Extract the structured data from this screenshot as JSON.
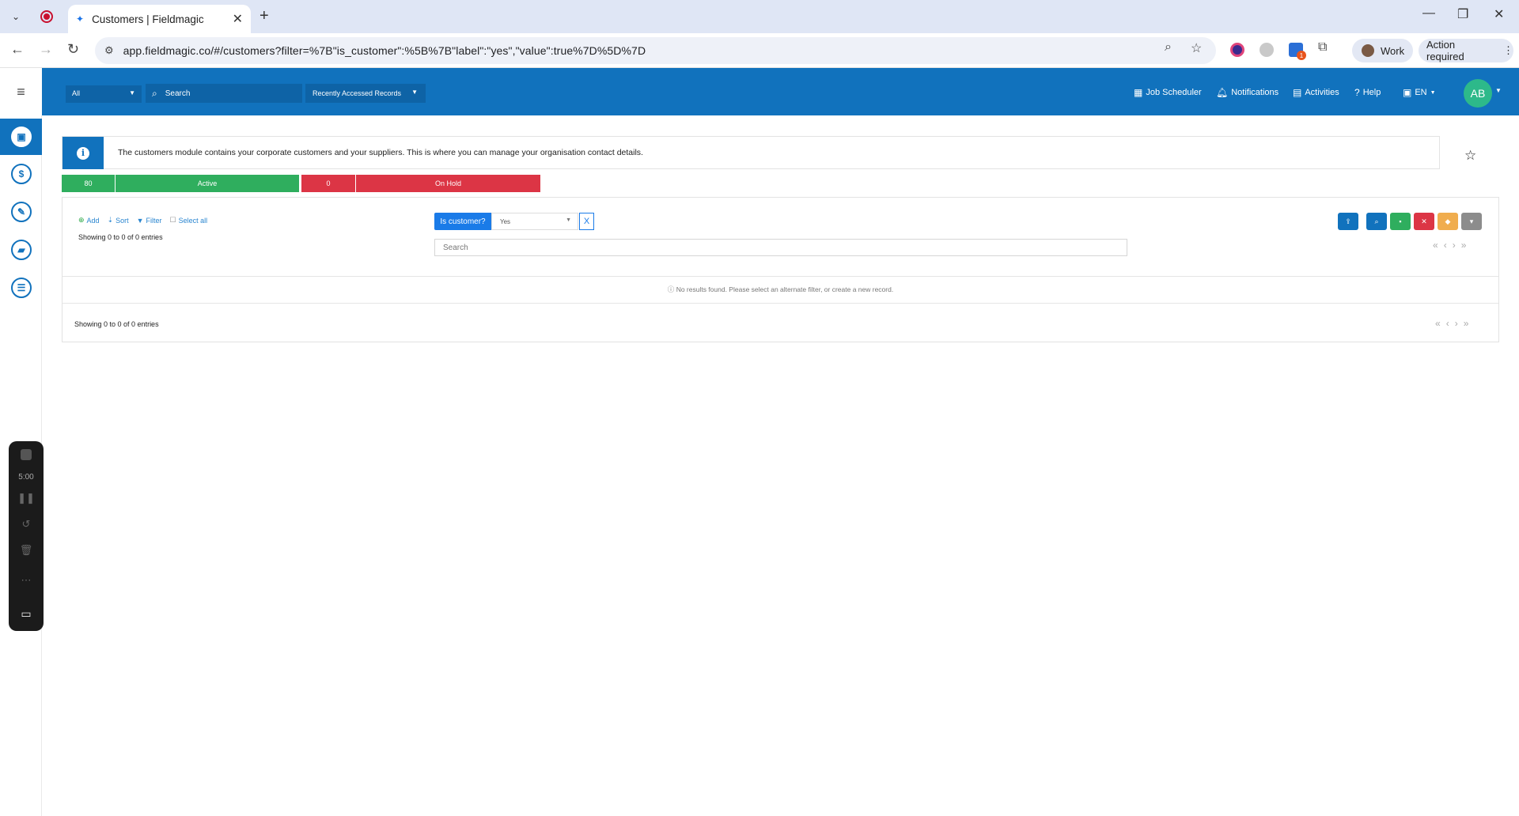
{
  "browser": {
    "tab_title": "Customers | Fieldmagic",
    "url": "app.fieldmagic.co/#/customers?filter=%7B\"is_customer\":%5B%7B\"label\":\"yes\",\"value\":true%7D%5D%7D",
    "profile_label": "Work",
    "action_label": "Action required",
    "extension_badge": "1"
  },
  "header": {
    "scope_select": "All",
    "search_placeholder": "Search",
    "recent_label": "Recently Accessed Records",
    "links": {
      "job_scheduler": "Job Scheduler",
      "notifications": "Notifications",
      "activities": "Activities",
      "help": "Help",
      "language": "EN"
    },
    "avatar_initials": "AB"
  },
  "sidebar": {
    "icons": [
      "customers-icon",
      "dollar-icon",
      "wrench-icon",
      "briefcase-icon",
      "inventory-icon"
    ]
  },
  "recorder": {
    "time": "5:00"
  },
  "info_text": "The customers module contains your corporate customers and your suppliers. This is where you can manage your organisation contact details.",
  "stats": {
    "active_count": "80",
    "active_label": "Active",
    "onhold_count": "0",
    "onhold_label": "On Hold"
  },
  "toolbar": {
    "add": "Add",
    "sort": "Sort",
    "filter": "Filter",
    "select_all": "Select all"
  },
  "filter": {
    "tag_label": "Is customer?",
    "value": "Yes",
    "clear": "X"
  },
  "list": {
    "search_placeholder": "Search",
    "showing_top": "Showing 0 to 0 of 0 entries",
    "showing_bottom": "Showing 0 to 0 of 0 entries",
    "no_results": "No results found. Please select an alternate filter, or create a new record."
  },
  "colors": {
    "brand": "#1172bd",
    "active": "#2fae5e",
    "onhold": "#dc3545"
  }
}
